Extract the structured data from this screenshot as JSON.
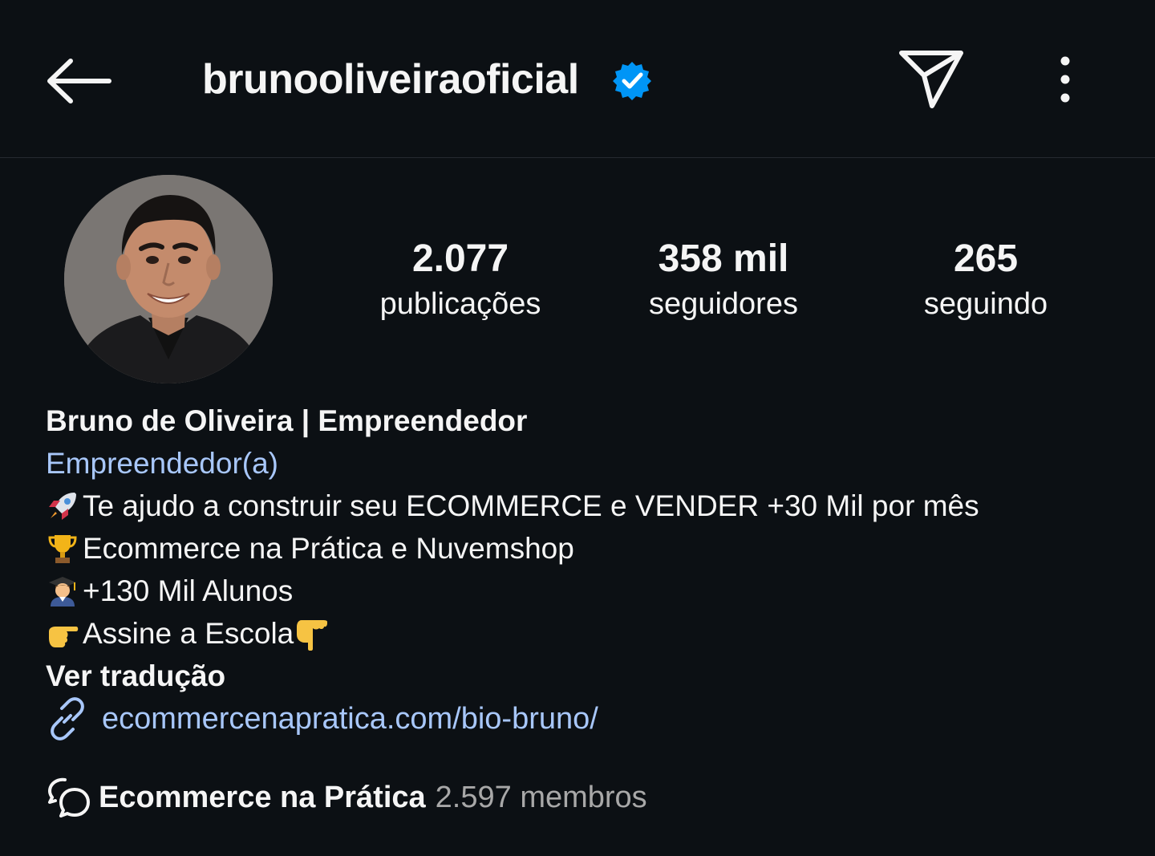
{
  "header": {
    "username": "brunooliveiraoficial",
    "verified": true,
    "icons": {
      "back": "back-arrow-icon",
      "verified": "verified-badge-icon",
      "send": "send-message-icon",
      "more": "more-options-icon"
    }
  },
  "profile": {
    "avatar_alt": "profile-photo",
    "stats": [
      {
        "value": "2.077",
        "label": "publicações"
      },
      {
        "value": "358 mil",
        "label": "seguidores"
      },
      {
        "value": "265",
        "label": "seguindo"
      }
    ]
  },
  "bio": {
    "name": "Bruno de Oliveira | Empreendedor",
    "category": "Empreendedor(a)",
    "lines": [
      {
        "emoji": "rocket-icon",
        "text": "Te ajudo a construir seu ECOMMERCE e VENDER +30 Mil por mês"
      },
      {
        "emoji": "trophy-icon",
        "text": "Ecommerce na Prática e Nuvemshop"
      },
      {
        "emoji": "student-icon",
        "text": "+130 Mil Alunos"
      },
      {
        "emoji": "pointing-right-icon",
        "text": "Assine a Escola",
        "trailing_emoji": "pointing-down-icon"
      }
    ],
    "translate_label": "Ver tradução",
    "link": "ecommercenapratica.com/bio-bruno/",
    "channel": {
      "name": "Ecommerce na Prática",
      "members": "2.597 membros"
    }
  },
  "colors": {
    "background": "#0c1014",
    "text": "#f5f5f5",
    "link": "#a8c7fa",
    "muted": "#a8a8a8",
    "verified": "#0095f6"
  }
}
